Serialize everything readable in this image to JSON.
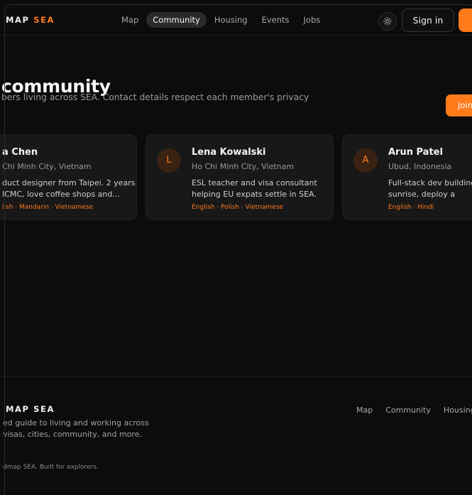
{
  "header": {
    "brand_prefix": "MAP",
    "brand_accent": "SEA",
    "nav": [
      "Map",
      "Community",
      "Housing",
      "Events",
      "Jobs"
    ],
    "active_nav": "Community",
    "theme_icon": "sun-icon",
    "signin_label": "Sign in"
  },
  "hero": {
    "title": "community",
    "subtitle": "bers living across SEA. Contact details respect each member's privacy",
    "join_label": "Join"
  },
  "members": [
    {
      "initial": "",
      "name": "a Chen",
      "location": "Chi Minh City, Vietnam",
      "bio": "duct designer from Taipei. 2 years ICMC, love coffee shops and...",
      "languages": "lish · Mandarin · Vietnamese"
    },
    {
      "initial": "L",
      "name": "Lena Kowalski",
      "location": "Ho Chi Minh City, Vietnam",
      "bio": "ESL teacher and visa consultant helping EU expats settle in SEA.",
      "languages": "English · Polish · Vietnamese"
    },
    {
      "initial": "A",
      "name": "Arun Patel",
      "location": "Ubud, Indonesia",
      "bio": "Full-stack dev building fr Yoga at sunrise, deploy a",
      "languages": "English · Hindi"
    }
  ],
  "footer": {
    "brand": "MAP SEA",
    "description": "ed guide to living and working across\nvisas, cities, community, and more.",
    "copyright": "dmap SEA. Built for explorers.",
    "links": [
      "Map",
      "Community",
      "Housing"
    ]
  },
  "colors": {
    "accent": "#ff7a1a",
    "background": "#0c0c0c",
    "card": "#181818"
  }
}
